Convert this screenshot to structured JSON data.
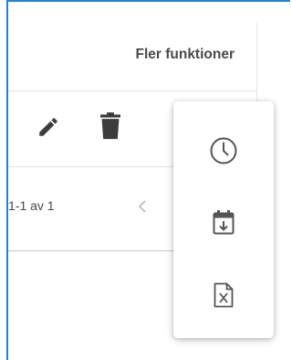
{
  "header": {
    "more_functions_label": "Fler funktioner"
  },
  "toolbar": {
    "edit_icon": "pencil-icon",
    "delete_icon": "trash-icon"
  },
  "pagination": {
    "range_text": "1-1 av 1",
    "prev_icon": "chevron-left-icon"
  },
  "more_menu": {
    "items": [
      {
        "icon": "clock-icon"
      },
      {
        "icon": "calendar-download-icon"
      },
      {
        "icon": "excel-file-icon"
      }
    ]
  },
  "colors": {
    "frame_border": "#1f84d6",
    "icon_dark": "#3c3c3c",
    "icon_grey": "#555555",
    "chevron": "#bdbdbd"
  }
}
